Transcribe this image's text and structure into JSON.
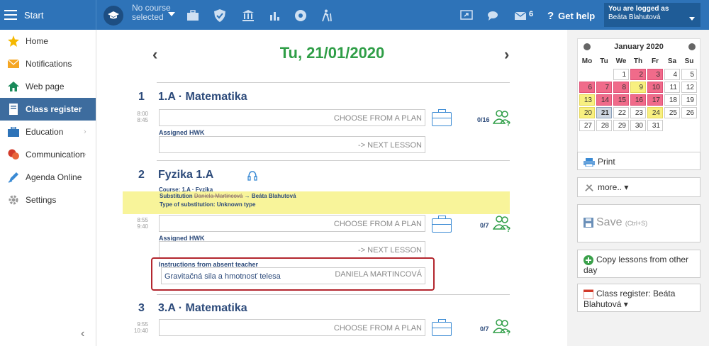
{
  "topbar": {
    "start_label": "Start",
    "course_label": "No course\nselected",
    "messages_count": "6",
    "help_label": "Get help",
    "logged_as_label": "You are logged as",
    "user_name": "Beáta Blahutová"
  },
  "sidebar": {
    "items": [
      {
        "label": "Home",
        "icon": "star-icon"
      },
      {
        "label": "Notifications",
        "icon": "envelope-icon"
      },
      {
        "label": "Web page",
        "icon": "house-icon"
      },
      {
        "label": "Class register",
        "icon": "notebook-icon",
        "active": true
      },
      {
        "label": "Education",
        "icon": "briefcase-icon"
      },
      {
        "label": "Communication",
        "icon": "chat-icon"
      },
      {
        "label": "Agenda Online",
        "icon": "pen-icon"
      },
      {
        "label": "Settings",
        "icon": "gear-icon"
      }
    ]
  },
  "main": {
    "date": "Tu, 21/01/2020",
    "lessons": [
      {
        "number": "1",
        "title": "1.A · Matematika",
        "time_start": "8:00",
        "time_end": "8:45",
        "plan_label": "CHOOSE FROM A PLAN",
        "count": "0/16",
        "hwk_label": "Assigned HWK",
        "next_lesson_label": "-> NEXT LESSON"
      },
      {
        "number": "2",
        "title": "Fyzika  1.A",
        "course_line_label": "Course:",
        "course_line_value": "1.A · Fyzika",
        "substitution_label": "Substitution",
        "substitution_from": "Daniela Martincová",
        "substitution_to": "→ Beáta Blahutová",
        "sub_type_label": "Type of substitution:",
        "sub_type_value": "Unknown type",
        "time_start": "8:55",
        "time_end": "9:40",
        "plan_label": "CHOOSE FROM A PLAN",
        "count": "0/7",
        "hwk_label": "Assigned HWK",
        "next_lesson_label": "-> NEXT LESSON",
        "instructions_label": "Instructions from absent teacher",
        "instructions_text": "Gravitačná sila a hmotnosť telesa",
        "instructions_author": "DANIELA MARTINCOVÁ"
      },
      {
        "number": "3",
        "title": "3.A · Matematika",
        "time_start": "9:55",
        "time_end": "10:40",
        "plan_label": "CHOOSE FROM A PLAN",
        "count": "0/7"
      }
    ]
  },
  "calendar": {
    "month": "January 2020",
    "weekdays": [
      "Mo",
      "Tu",
      "We",
      "Th",
      "Fr",
      "Sa",
      "Su"
    ],
    "weeks": [
      [
        {
          "d": ""
        },
        {
          "d": ""
        },
        {
          "d": "1"
        },
        {
          "d": "2",
          "c": "pink"
        },
        {
          "d": "3",
          "c": "pink"
        },
        {
          "d": "4"
        },
        {
          "d": "5"
        }
      ],
      [
        {
          "d": "6",
          "c": "pink"
        },
        {
          "d": "7",
          "c": "pink"
        },
        {
          "d": "8",
          "c": "pink"
        },
        {
          "d": "9",
          "c": "yel"
        },
        {
          "d": "10",
          "c": "pink"
        },
        {
          "d": "11"
        },
        {
          "d": "12"
        }
      ],
      [
        {
          "d": "13",
          "c": "yel"
        },
        {
          "d": "14",
          "c": "pink"
        },
        {
          "d": "15",
          "c": "pink"
        },
        {
          "d": "16",
          "c": "pink"
        },
        {
          "d": "17",
          "c": "pink"
        },
        {
          "d": "18"
        },
        {
          "d": "19"
        }
      ],
      [
        {
          "d": "20",
          "c": "yel"
        },
        {
          "d": "21",
          "c": "sel"
        },
        {
          "d": "22"
        },
        {
          "d": "23"
        },
        {
          "d": "24",
          "c": "yel"
        },
        {
          "d": "25"
        },
        {
          "d": "26"
        }
      ],
      [
        {
          "d": "27"
        },
        {
          "d": "28"
        },
        {
          "d": "29"
        },
        {
          "d": "30"
        },
        {
          "d": "31"
        },
        {
          "d": ""
        },
        {
          "d": ""
        }
      ]
    ]
  },
  "right": {
    "print_label": "Print",
    "more_label": "more.. ▾",
    "save_label": "Save",
    "save_shortcut": "(Ctrl+S)",
    "copy_label": "Copy lessons from other day",
    "register_label": "Class register: Beáta Blahutová ▾"
  },
  "colors": {
    "topbar": "#2e73b8",
    "date_green": "#2f9e47",
    "highlight_red": "#b3262e",
    "substitution_yellow": "#f8f49a"
  }
}
